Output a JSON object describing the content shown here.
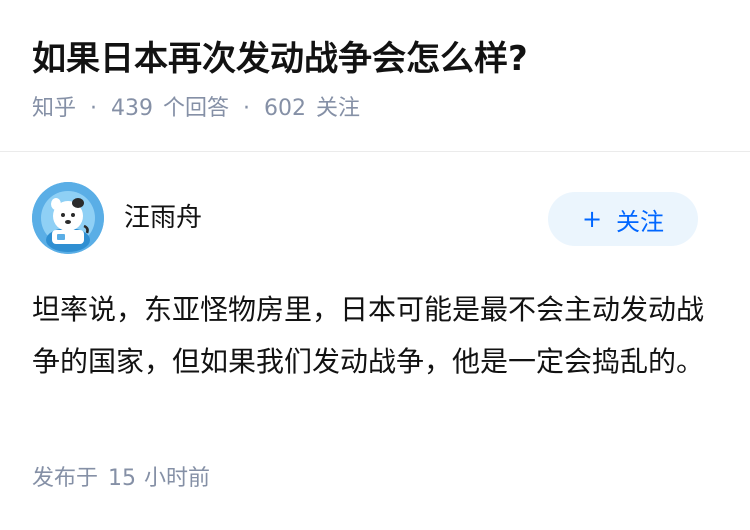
{
  "question": {
    "title": "如果日本再次发动战争会怎么样?",
    "source": "知乎",
    "separator": "·",
    "answer_count": "439",
    "answer_label": "个回答",
    "follower_count": "602",
    "follower_label": "关注"
  },
  "answer": {
    "author_name": "汪雨舟",
    "follow_button": {
      "icon": "+",
      "label": "关注"
    },
    "content": "坦率说，东亚怪物房里，日本可能是最不会主动发动战争的国家，但如果我们发动战争，他是一定会捣乱的。",
    "published_prefix": "发布于",
    "published_value": "15",
    "published_unit": "小时前"
  },
  "colors": {
    "meta_gray": "#8590a6",
    "accent_blue": "#0066ff",
    "button_bg": "#ebf5fd"
  }
}
